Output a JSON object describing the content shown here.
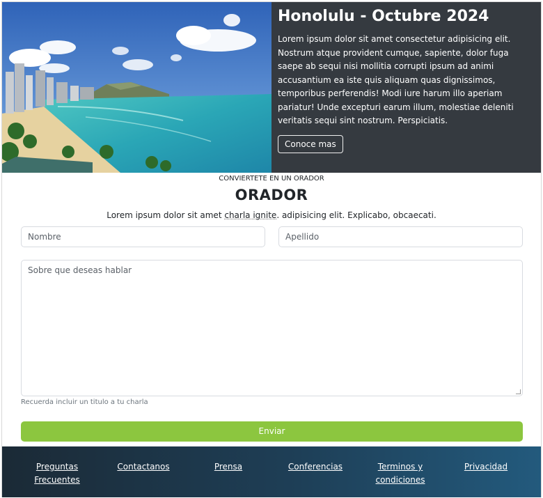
{
  "hero": {
    "title": "Honolulu - Octubre 2024",
    "text": "Lorem ipsum dolor sit amet consectetur adipisicing elit. Nostrum atque provident cumque, sapiente, dolor fuga saepe ab sequi nisi mollitia corrupti ipsum ad animi accusantium ea iste quis aliquam quas dignissimos, temporibus perferendis! Modi iure harum illo aperiam pariatur! Unde excepturi earum illum, molestiae deleniti veritatis sequi sint nostrum. Perspiciatis.",
    "button_label": "Conoce mas"
  },
  "form": {
    "overline": "CONVIERTETE EN UN ORADOR",
    "title": "ORADOR",
    "lead_before": "Lorem ipsum dolor sit amet ",
    "lead_squiggle": "charla ignite",
    "lead_after": ". adipisicing elit. Explicabo, obcaecati.",
    "nombre_placeholder": "Nombre",
    "apellido_placeholder": "Apellido",
    "textarea_placeholder": "Sobre que deseas hablar",
    "help_text": "Recuerda incluir un titulo a tu charla",
    "submit_label": "Enviar"
  },
  "footer": {
    "links": [
      "Preguntas Frecuentes",
      "Contactanos",
      "Prensa",
      "Conferencias",
      "Terminos y condiciones",
      "Privacidad"
    ]
  },
  "colors": {
    "hero_panel": "#353a40",
    "submit": "#8cc63f",
    "footer_start": "#1b2a36",
    "footer_end": "#235a7d"
  }
}
